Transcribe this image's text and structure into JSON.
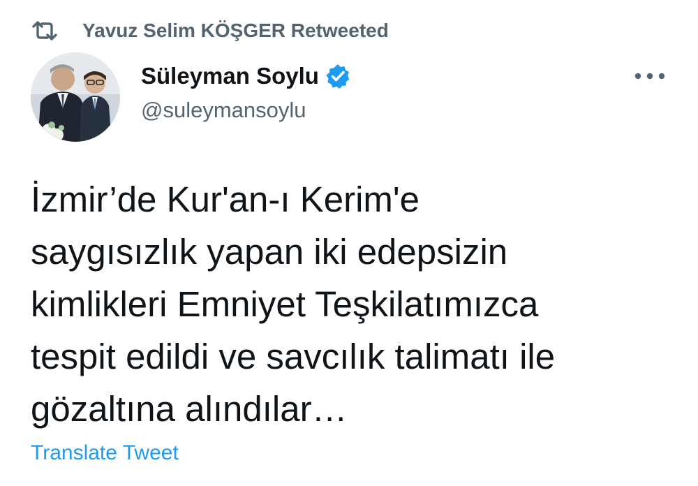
{
  "retweet": {
    "icon": "retweet-icon",
    "text": "Yavuz Selim KÖŞGER Retweeted"
  },
  "author": {
    "display_name": "Süleyman Soylu",
    "handle": "@suleymansoylu",
    "verified_icon": "verified-badge-icon",
    "avatar": "avatar"
  },
  "menu": {
    "icon": "more-options-icon"
  },
  "tweet": {
    "text": "İzmir’de Kur'an-ı Kerim'e\nsaygısızlık yapan iki edepsizin\nkimlikleri Emniyet Teşkilatımızca\ntespit edildi ve savcılık talimatı ile\ngözaltına alındılar…"
  },
  "translate": {
    "label": "Translate Tweet"
  },
  "colors": {
    "accent": "#1d9bf0",
    "secondary_text": "#536471",
    "primary_text": "#0f1419",
    "background": "#ffffff"
  }
}
